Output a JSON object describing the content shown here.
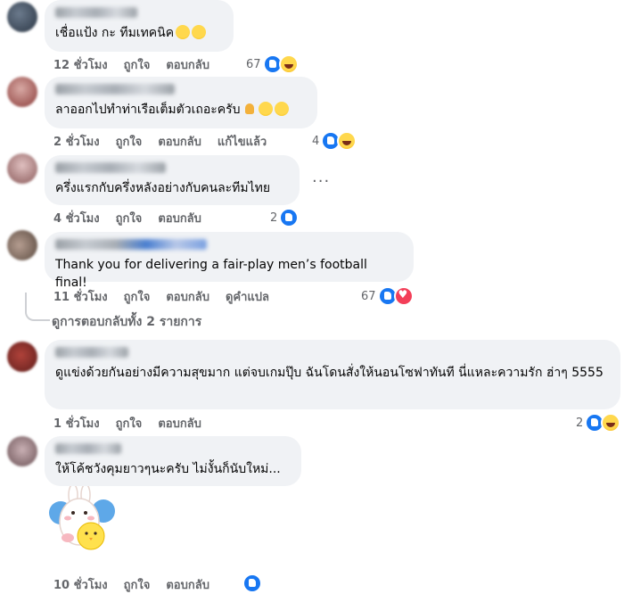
{
  "labels": {
    "like": "ถูกใจ",
    "reply": "ตอบกลับ",
    "edited": "แก้ไขแล้ว",
    "translate": "ดูคำแปล"
  },
  "comments": [
    {
      "text": "เชื่อแป้ง กะ ทีมเทคนิค",
      "time": "12 ชั่วโมง",
      "reactions": "67"
    },
    {
      "text": "ลาออกไปทำท่าเรือเต็มตัวเถอะครับ",
      "time": "2 ชั่วโมง",
      "reactions": "4"
    },
    {
      "text": "ครึ่งแรกกับครึ่งหลังอย่างกับคนละทีมไทย",
      "time": "4 ชั่วโมง",
      "reactions": "2",
      "more": "..."
    },
    {
      "text": "Thank you for delivering a fair-play men’s football final!",
      "time": "11 ชั่วโมง",
      "reactions": "67"
    },
    {
      "text": "ดูแข่งด้วยกันอย่างมีความสุขมาก แต่จบเกมปุ๊บ ฉันโดนสั่งให้นอนโซฟาทันที นี่แหละความรัก ฮ่าๆ 5555",
      "time": "1 ชั่วโมง",
      "reactions": "2"
    },
    {
      "text": "ให้โค้ชวังคุมยาวๆนะครับ ไม่งั้นก็นับใหม่...",
      "time": "10 ชั่วโมง"
    }
  ],
  "replies_link": "ดูการตอบกลับทั้ง 2 รายการ",
  "colors": {
    "bubble": "#f0f2f5",
    "meta": "#65676b",
    "like": "#1877f2",
    "love": "#f33e58",
    "haha": "#f5c33b"
  }
}
